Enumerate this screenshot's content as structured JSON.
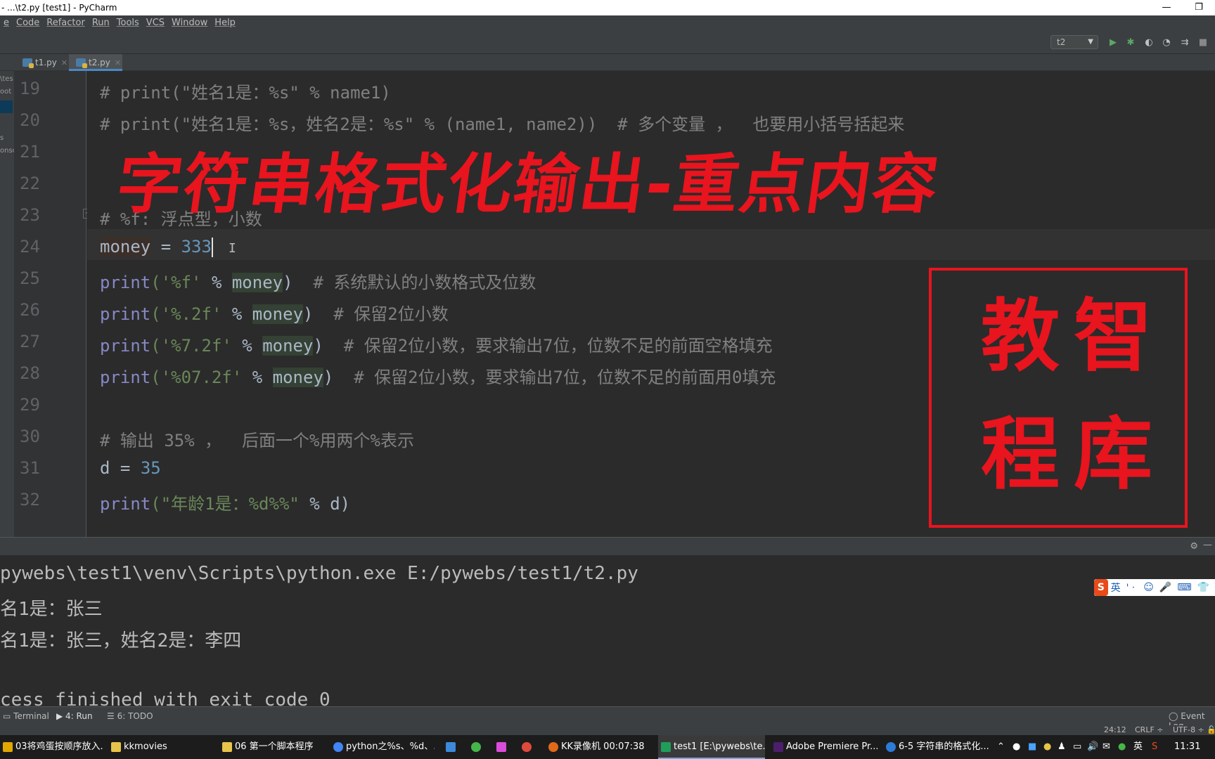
{
  "window": {
    "title": "- ...\\t2.py [test1] - PyCharm"
  },
  "menu": [
    "e",
    "Code",
    "Refactor",
    "Run",
    "Tools",
    "VCS",
    "Window",
    "Help"
  ],
  "toolbar": {
    "run_config": "t2"
  },
  "tabs": [
    {
      "label": "t1.py",
      "active": false
    },
    {
      "label": "t2.py",
      "active": true
    }
  ],
  "left_strip": {
    "labels": [
      "\\tes",
      "oot",
      "s",
      "onsc"
    ]
  },
  "editor": {
    "line_numbers": [
      "19",
      "20",
      "21",
      "22",
      "23",
      "24",
      "25",
      "26",
      "27",
      "28",
      "29",
      "30",
      "31",
      "32"
    ],
    "lines": {
      "l19": "# print(\"姓名1是：%s\" % name1)",
      "l20": "# print(\"姓名1是：%s，姓名2是：%s\" % (name1, name2))  # 多个变量 ，  也要用小括号括起来",
      "l23": "# %f: 浮点型，小数",
      "l24_a": "money",
      "l24_b": " = ",
      "l24_c": "333",
      "l25_a": "print",
      "l25_b": "('%f'",
      "l25_c": " % ",
      "l25_d": "money",
      "l25_e": ")  ",
      "l25_f": "# 系统默认的小数格式及位数",
      "l26_a": "print",
      "l26_b": "('%.2f'",
      "l26_c": " % ",
      "l26_d": "money",
      "l26_e": ")  ",
      "l26_f": "# 保留2位小数",
      "l27_a": "print",
      "l27_b": "('%7.2f'",
      "l27_c": " % ",
      "l27_d": "money",
      "l27_e": ")  ",
      "l27_f": "# 保留2位小数，要求输出7位，位数不足的前面空格填充",
      "l28_a": "print",
      "l28_b": "('%07.2f'",
      "l28_c": " % ",
      "l28_d": "money",
      "l28_e": ")  ",
      "l28_f": "# 保留2位小数，要求输出7位，位数不足的前面用0填充",
      "l30": "# 输出 35% ，  后面一个%用两个%表示",
      "l31_a": "d",
      "l31_b": " = ",
      "l31_c": "35",
      "l32_a": "print",
      "l32_b": "(\"年龄1是：%d%%\"",
      "l32_c": " % d)"
    }
  },
  "overlay": {
    "title": "字符串格式化输出-重点内容",
    "seal": [
      "教",
      "智",
      "程",
      "库"
    ]
  },
  "run_output": {
    "lines": [
      "pywebs\\test1\\venv\\Scripts\\python.exe E:/pywebs/test1/t2.py",
      "名1是：张三",
      "名1是：张三，姓名2是：李四",
      "",
      "cess finished with exit code 0"
    ]
  },
  "ime": {
    "logo": "S",
    "mode": "英",
    "items": [
      "'ㆍ",
      "☺",
      "🎤",
      "⌨",
      "👕"
    ]
  },
  "bottom_tools": {
    "terminal": "Terminal",
    "run": "4: Run",
    "todo": "6: TODO",
    "event_log": "Event Log"
  },
  "status": {
    "position": "24:12",
    "line_sep": "CRLF ÷",
    "encoding": "UTF-8 ÷"
  },
  "taskbar": {
    "items": [
      {
        "label": "03将鸡蛋按顺序放入...",
        "color": "#e0a800"
      },
      {
        "label": "kkmovies",
        "color": "#e8c44a"
      },
      {
        "label": "06 第一个脚本程序",
        "color": "#e8c44a"
      },
      {
        "label": "python之%s、%d、...",
        "color": "#4285f4"
      },
      {
        "label": "",
        "color": "#3c8ad8"
      },
      {
        "label": "",
        "color": "#45b649"
      },
      {
        "label": "",
        "color": "#d94dd9"
      },
      {
        "label": "",
        "color": "#e04a3c"
      },
      {
        "label": "KK录像机 00:07:38",
        "color": "#e06a1a"
      },
      {
        "label": "test1 [E:\\pywebs\\te...",
        "color": "#1f9e5a"
      },
      {
        "label": "Adobe Premiere Pr...",
        "color": "#4b1f6b"
      },
      {
        "label": "6-5 字符串的格式化...",
        "color": "#2d7bd6"
      }
    ],
    "tray_lang": "英",
    "clock": "11:31"
  }
}
